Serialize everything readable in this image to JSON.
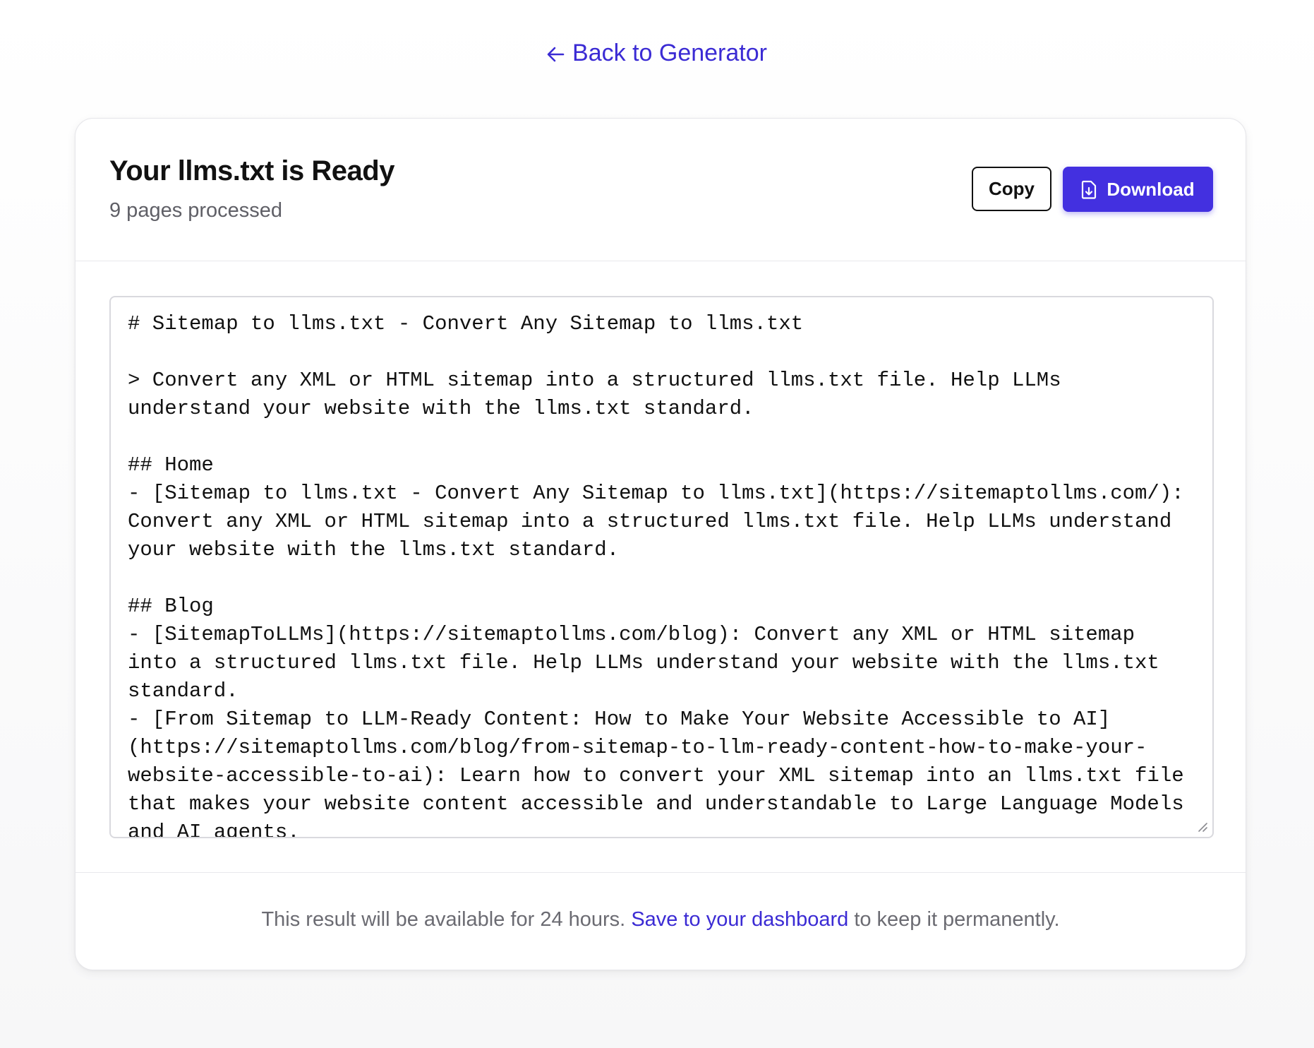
{
  "back_link": {
    "label": "Back to Generator"
  },
  "header": {
    "title": "Your llms.txt is Ready",
    "subtitle": "9 pages processed",
    "copy_label": "Copy",
    "download_label": "Download"
  },
  "output": {
    "content": "# Sitemap to llms.txt - Convert Any Sitemap to llms.txt\n\n> Convert any XML or HTML sitemap into a structured llms.txt file. Help LLMs understand your website with the llms.txt standard.\n\n## Home\n- [Sitemap to llms.txt - Convert Any Sitemap to llms.txt](https://sitemaptollms.com/): Convert any XML or HTML sitemap into a structured llms.txt file. Help LLMs understand your website with the llms.txt standard.\n\n## Blog\n- [SitemapToLLMs](https://sitemaptollms.com/blog): Convert any XML or HTML sitemap into a structured llms.txt file. Help LLMs understand your website with the llms.txt standard.\n- [From Sitemap to LLM-Ready Content: How to Make Your Website Accessible to AI](https://sitemaptollms.com/blog/from-sitemap-to-llm-ready-content-how-to-make-your-website-accessible-to-ai): Learn how to convert your XML sitemap into an llms.txt file that makes your website content accessible and understandable to Large Language Models and AI agents."
  },
  "footer": {
    "text_before": "This result will be available for 24 hours.",
    "link_label": "Save to your dashboard",
    "text_after": "to keep it permanently."
  },
  "colors": {
    "accent": "#4330e0",
    "link": "#3b2bd4",
    "muted_text": "#6b6b72"
  },
  "icons": {
    "back": "arrow-left-icon",
    "download": "file-download-icon"
  }
}
